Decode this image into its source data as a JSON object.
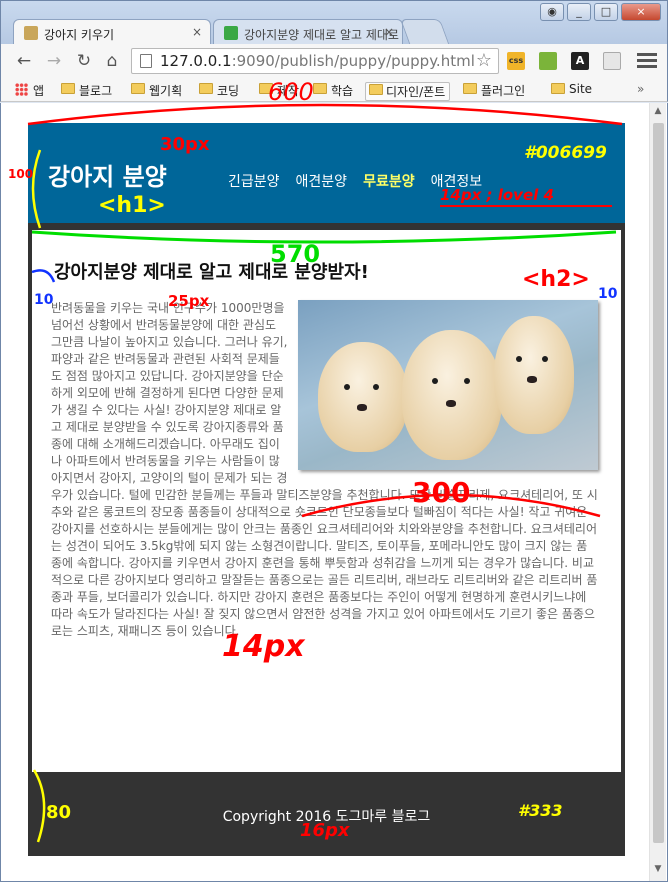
{
  "browser": {
    "tabs": [
      {
        "title": "강아지 키우기",
        "close": "×"
      },
      {
        "title": "강아지분양 제대로 알고 제대로 분양받자!",
        "close": "×"
      }
    ],
    "window_buttons": [
      "_",
      "□",
      "×"
    ],
    "url_host": "127.0.0.1",
    "url_path": ":9090/publish/puppy/puppy.html",
    "extensions": [
      "css",
      "A"
    ],
    "bookmarks": [
      "앱",
      "블로그",
      "웹기획",
      "코딩",
      "제작",
      "학습",
      "디자인/폰트",
      "플러그인",
      "Site"
    ],
    "bookmarks_more": "»"
  },
  "page": {
    "site_title": "강아지 분양",
    "nav": [
      "긴급분양",
      "애견분양",
      "무료분양",
      "애견정보"
    ],
    "nav_active_index": 2,
    "article_title": "강아지분양 제대로 알고 제대로 분양받자!",
    "article_text": "반려동물을 키우는 국내 인구수가 1000만명을 넘어선 상황에서 반려동물분양에 대한 관심도 그만큼 나날이 높아지고 있습니다. 그러나 유기, 파양과 같은 반려동물과 관련된 사회적 문제들도 점점 많아지고 있답니다. 강아지분양을 단순하게 외모에 반해 결정하게 된다면 다양한 문제가 생길 수 있다는 사실! 강아지분양 제대로 알고 제대로 분양받을 수 있도록 강아지종류와 품종에 대해 소개해드리겠습니다. 아무래도 집이나 아파트에서 반려동물을 키우는 사람들이 많아지면서 강아지, 고양이의 털이 문제가 되는 경우가 있습니다. 털에 민감한 분들께는 푸들과 말티즈분양을 추천합니다. 또한 비숑프리제, 요크셔테리어, 또 시추와 같은 롱코트의 장모종 품종들이 상대적으로 숏코트인 단모종들보다 털빠짐이 적다는 사실! 작고 귀여운 강아지를 선호하시는 분들에게는 많이 안크는 품종인 요크셔테리어와 치와와분양을 추천합니다. 요크셔테리어는 성견이 되어도 3.5kg밖에 되지 않는 소형견이랍니다. 말티즈, 토이푸들, 포메라니안도 많이 크지 않는 품종에 속합니다. 강아지를 키우면서 강아지 훈련을 통해 뿌듯함과 성취감을 느끼게 되는 경우가 많습니다. 비교적으로 다른 강아지보다 영리하고 말잘듣는 품종으로는 골든 리트리버, 래브라도 리트리버와 같은 리트리버 품종과 푸들, 보더콜리가 있습니다. 하지만 강아지 훈련은 품종보다는 주인이 어떻게 현명하게 훈련시키느냐에 따라 속도가 달라진다는 사실! 잘 짖지 않으면서 얌전한 성격을 가지고 있어 아파트에서도 기르기 좋은 품종으로는 스피츠, 재패니즈 등이 있습니다.",
    "footer": "Copyright 2016 도그마루 블로그"
  },
  "colors": {
    "header": "#006699",
    "footer": "#333",
    "nav_active": "#ffff66",
    "annot_red": "#ff0000",
    "annot_yellow": "#ffff00",
    "annot_green": "#00dd00",
    "annot_blue": "#1133ff"
  },
  "annotations": {
    "total_width": "600",
    "header_height": "100",
    "h1_size": "30px",
    "h1_tag": "<h1>",
    "header_color": "#006699",
    "nav_note": "14px ; lovel 4",
    "content_width": "570",
    "h2_tag": "<h2>",
    "h2_size": "25px",
    "left_padding": "10",
    "right_padding": "10",
    "image_width": "300",
    "text_size": "14px",
    "footer_height": "80",
    "footer_size": "16px",
    "footer_color": "#333"
  }
}
